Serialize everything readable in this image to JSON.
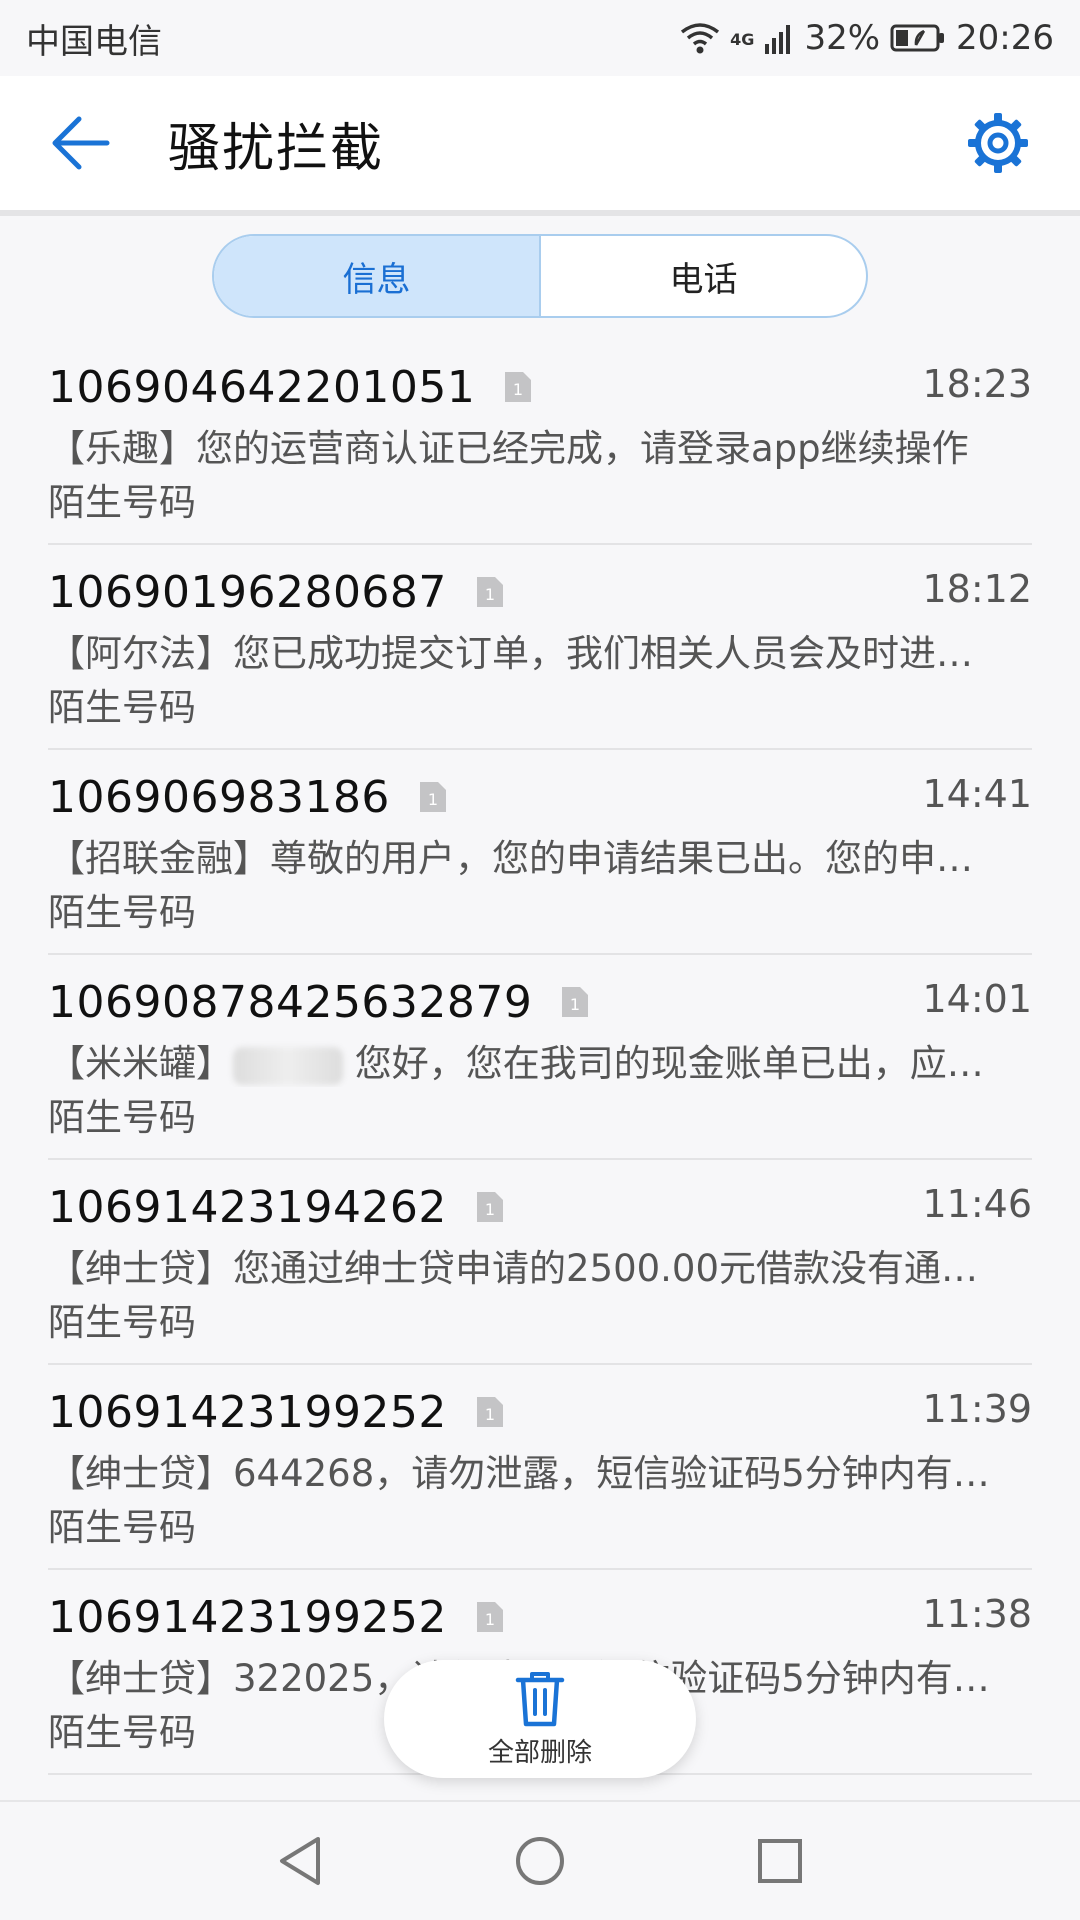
{
  "status_bar": {
    "carrier": "中国电信",
    "network": "4G",
    "battery_percent": "32%",
    "time": "20:26"
  },
  "app_bar": {
    "title": "骚扰拦截",
    "back_icon": "back-arrow-icon",
    "settings_icon": "gear-icon",
    "accent_color": "#1a73d6"
  },
  "tabs": [
    {
      "label": "信息",
      "active": true
    },
    {
      "label": "电话",
      "active": false
    }
  ],
  "messages": [
    {
      "sender": "106904642201051",
      "time": "18:23",
      "preview": "【乐趣】您的运营商认证已经完成，请登录app继续操作",
      "tag": "陌生号码"
    },
    {
      "sender": "10690196280687",
      "time": "18:12",
      "preview": "【阿尔法】您已成功提交订单，我们相关人员会及时进…",
      "tag": "陌生号码"
    },
    {
      "sender": "106906983186",
      "time": "14:41",
      "preview": "【招联金融】尊敬的用户，您的申请结果已出。您的申…",
      "tag": "陌生号码"
    },
    {
      "sender": "10690878425632879",
      "time": "14:01",
      "preview_prefix": "【米米罐】",
      "preview": "您好，您在我司的现金账单已出，应…",
      "tag": "陌生号码"
    },
    {
      "sender": "10691423194262",
      "time": "11:46",
      "preview": "【绅士贷】您通过绅士贷申请的2500.00元借款没有通…",
      "tag": "陌生号码"
    },
    {
      "sender": "10691423199252",
      "time": "11:39",
      "preview": "【绅士贷】644268，请勿泄露，短信验证码5分钟内有…",
      "tag": "陌生号码"
    },
    {
      "sender": "10691423199252",
      "time": "11:38",
      "preview": "【绅士贷】322025，请勿泄露，短信验证码5分钟内有…",
      "tag": "陌生号码"
    }
  ],
  "sim_label": "1",
  "fab": {
    "label": "全部删除",
    "icon": "trash-icon"
  },
  "nav_bar": {
    "icons": [
      "back-triangle-icon",
      "home-circle-icon",
      "recents-square-icon"
    ]
  }
}
